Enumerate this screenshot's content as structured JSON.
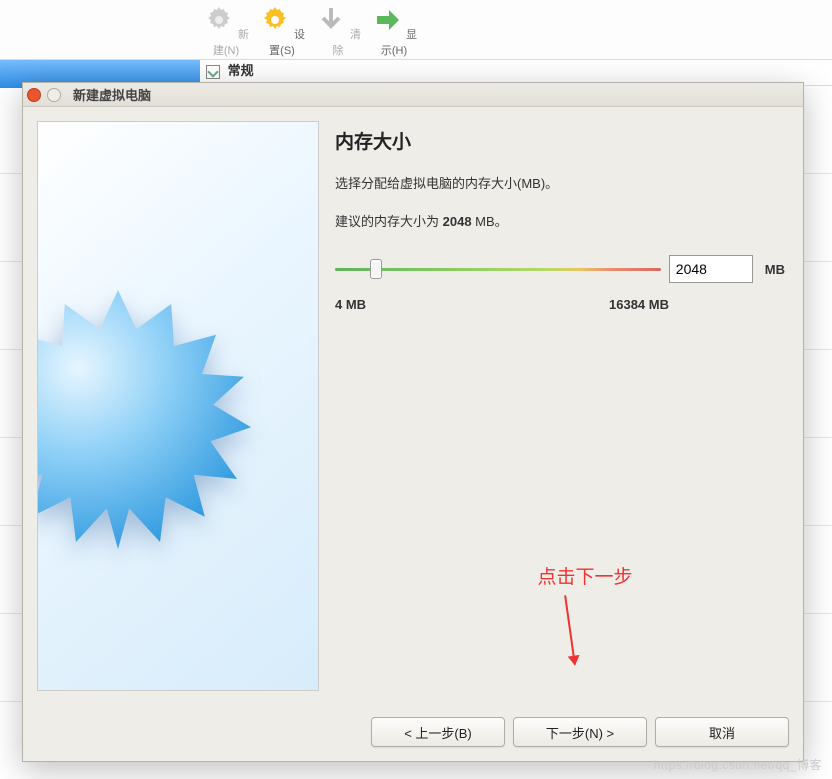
{
  "toolbar": {
    "new": {
      "label": "新建(N)"
    },
    "settings": {
      "label": "设置(S)"
    },
    "clear": {
      "label": "清除"
    },
    "show": {
      "label": "显示(H)"
    }
  },
  "tabstrip": {
    "first_label": "常规"
  },
  "dialog": {
    "title": "新建虚拟电脑",
    "heading": "内存大小",
    "desc1": "选择分配给虚拟电脑的内存大小(MB)。",
    "desc2_prefix": "建议的内存大小为 ",
    "desc2_bold": "2048",
    "desc2_suffix": " MB。",
    "slider": {
      "min_label": "4 MB",
      "max_label": "16384 MB",
      "min": 4,
      "max": 16384,
      "value": 2048,
      "unit": "MB"
    },
    "annotation": "点击下一步",
    "buttons": {
      "back": "< 上一步(B)",
      "next": "下一步(N) >",
      "cancel": "取消"
    }
  },
  "watermark": "https://blog.csdn.net/qq_博客"
}
